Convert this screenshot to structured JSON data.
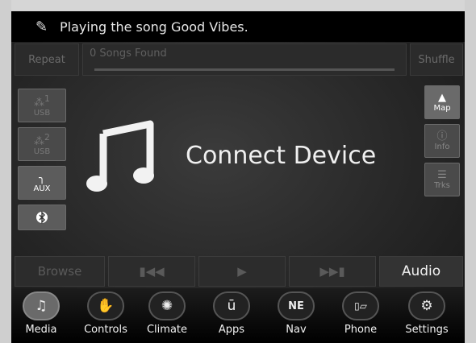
{
  "status": {
    "voice_icon": "voice-command-icon",
    "text": "Playing the song Good Vibes."
  },
  "top_row": {
    "repeat_label": "Repeat",
    "songs_found": "0 Songs Found",
    "shuffle_label": "Shuffle"
  },
  "left_sources": [
    {
      "label": "USB",
      "superscript": "1",
      "icon": "usb-icon"
    },
    {
      "label": "USB",
      "superscript": "2",
      "icon": "usb-icon"
    },
    {
      "label": "AUX",
      "icon": "aux-icon"
    },
    {
      "label": "",
      "icon": "bluetooth-icon"
    }
  ],
  "right_buttons": [
    {
      "label": "Map",
      "icon": "map-arrow-icon"
    },
    {
      "label": "Info",
      "icon": "info-icon"
    },
    {
      "label": "Trks",
      "icon": "tracks-list-icon"
    }
  ],
  "main": {
    "connect_label": "Connect Device",
    "icon": "music-note-icon"
  },
  "transport": {
    "browse_label": "Browse",
    "prev_icon": "previous-track-icon",
    "play_icon": "play-icon",
    "next_icon": "next-track-icon",
    "audio_label": "Audio"
  },
  "nav": [
    {
      "label": "Media",
      "icon": "music-note-icon",
      "active": true
    },
    {
      "label": "Controls",
      "icon": "controls-hand-icon",
      "active": false
    },
    {
      "label": "Climate",
      "icon": "climate-fan-icon",
      "active": false
    },
    {
      "label": "Apps",
      "icon": "apps-u-icon",
      "active": false
    },
    {
      "label": "Nav",
      "icon": "compass-ne-icon",
      "active": false,
      "compass": "NE"
    },
    {
      "label": "Phone",
      "icon": "phone-signal-icon",
      "active": false
    },
    {
      "label": "Settings",
      "icon": "gear-icon",
      "active": false
    }
  ],
  "colors": {
    "accent_active": "#6a6a6a",
    "background": "#262626",
    "text": "#f0f0f0"
  }
}
